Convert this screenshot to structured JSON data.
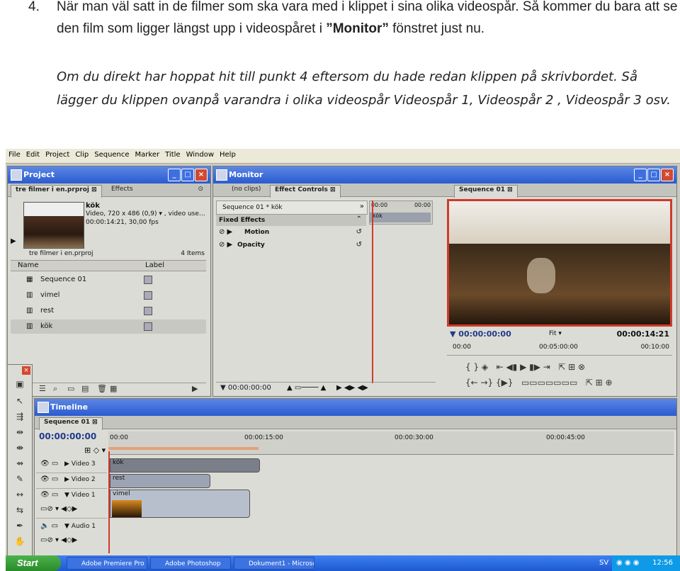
{
  "doc": {
    "num": "4.",
    "step_a": "När man väl satt in de filmer som ska vara med i klippet i sina olika videospår. Så kommer du bara att se den film som ligger längst upp i videospåret i ",
    "step_bold": "”Monitor”",
    "step_b": " fönstret just nu.",
    "note": "Om du direkt har hoppat hit till punkt 4 eftersom du hade redan klippen på skrivbordet. Så lägger du klippen ovanpå varandra i olika videospår Videospår 1, Videospår 2 , Videospår 3 osv."
  },
  "menu": [
    "File",
    "Edit",
    "Project",
    "Clip",
    "Sequence",
    "Marker",
    "Title",
    "Window",
    "Help"
  ],
  "project": {
    "title": "Project",
    "tab_active": "tre filmer i en.prproj",
    "tab_other": "Effects",
    "clip_name": "kök",
    "clip_info1": "Video, 720 x 486 (0,9)",
    "clip_info1b": ", video use…",
    "clip_info2": "00:00:14:21, 30,00 fps",
    "file_name": "tre filmer i en.prproj",
    "items_count": "4 Items",
    "col_name": "Name",
    "col_label": "Label",
    "items": [
      "Sequence 01",
      "vimel",
      "rest",
      "kök"
    ]
  },
  "monitor": {
    "title": "Monitor",
    "tab_noclips": "(no clips)",
    "tab_effects": "Effect Controls",
    "tab_sequence": "Sequence 01",
    "seq_label": "Sequence 01 * kök",
    "fixed_effects": "Fixed Effects",
    "fx_motion": "Motion",
    "fx_opacity": "Opacity",
    "ec_time_start": "00:00",
    "ec_time_end": "00:00",
    "ec_clip": "kök",
    "ec_timecode": "00:00:00:00",
    "mon_timecode": "00:00:00:00",
    "fit": "Fit",
    "duration": "00:00:14:21",
    "ruler_start": "00:00",
    "ruler_mid": "00:05:00:00",
    "ruler_end": "00:10:00"
  },
  "timeline": {
    "title": "Timeline",
    "seq_tab": "Sequence 01",
    "timecode": "00:00:00:00",
    "ruler": [
      "00:00",
      "00:00:15:00",
      "00:00:30:00",
      "00:00:45:00"
    ],
    "tracks": [
      {
        "name": "Video 3",
        "clip": "kök"
      },
      {
        "name": "Video 2",
        "clip": "rest"
      },
      {
        "name": "Video 1",
        "clip": "vimel"
      },
      {
        "name": "Audio 1",
        "clip": ""
      }
    ]
  },
  "taskbar": {
    "start": "Start",
    "tasks": [
      "Adobe Premiere Pro -…",
      "Adobe Photoshop",
      "Dokument1 - Microsof…"
    ],
    "lang": "SV",
    "clock": "12:56"
  },
  "colors": {
    "accent": "#2a5bd0",
    "selection": "#c8c8c2",
    "playhead": "#d03a2a",
    "clip_v3": "#7a7f8a"
  }
}
